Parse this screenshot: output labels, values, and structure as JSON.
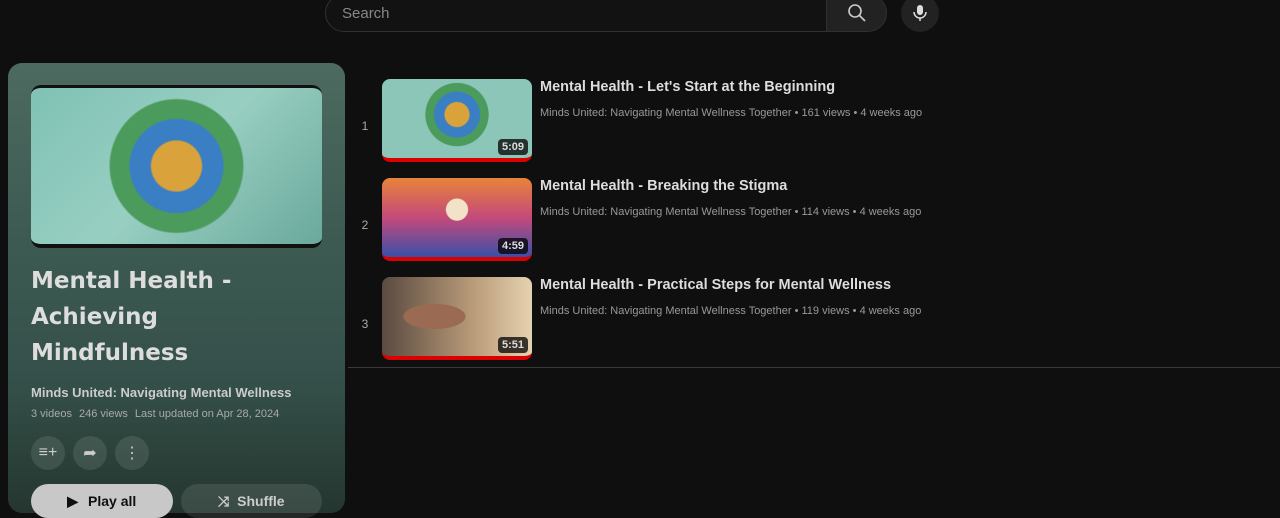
{
  "search": {
    "placeholder": "Search"
  },
  "playlist": {
    "title": "Mental Health - Achieving Mindfulness",
    "owner": "Minds United: Navigating Mental Wellness",
    "videos": "3 videos",
    "views": "246 views",
    "updated": "Last updated on Apr 28, 2024",
    "play_all": "Play all",
    "shuffle": "Shuffle"
  },
  "videos": [
    {
      "index": "1",
      "title": "Mental Health - Let's Start at the Beginning",
      "channel": "Minds United: Navigating Mental Wellness Together",
      "views": "161 views",
      "age": "4 weeks ago",
      "duration": "5:09"
    },
    {
      "index": "2",
      "title": "Mental Health - Breaking the Stigma",
      "channel": "Minds United: Navigating Mental Wellness Together",
      "views": "114 views",
      "age": "4 weeks ago",
      "duration": "4:59"
    },
    {
      "index": "3",
      "title": "Mental Health - Practical Steps for Mental Wellness",
      "channel": "Minds United: Navigating Mental Wellness Together",
      "views": "119 views",
      "age": "4 weeks ago",
      "duration": "5:51"
    }
  ]
}
